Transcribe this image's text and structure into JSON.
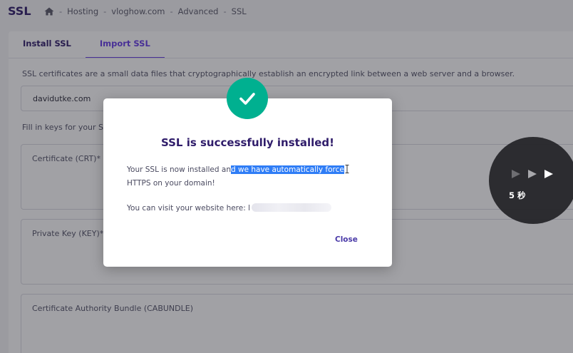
{
  "header": {
    "title": "SSL",
    "breadcrumb": [
      "Hosting",
      "vloghow.com",
      "Advanced",
      "SSL"
    ],
    "separator": "-"
  },
  "tabs": [
    {
      "label": "Install SSL",
      "active": false
    },
    {
      "label": "Import SSL",
      "active": true
    }
  ],
  "form": {
    "description": "SSL certificates are a small data files that cryptographically establish an encrypted link between a web server and a browser.",
    "domain_value": "davidutke.com",
    "fill_label": "Fill in keys for your SS",
    "certificate_label": "Certificate (CRT)*",
    "private_key_label": "Private Key (KEY)*",
    "cabundle_label": "Certificate Authority Bundle (CABUNDLE)"
  },
  "modal": {
    "title": "SSL is successfully installed!",
    "message_part1": "Your SSL is now installed an",
    "message_highlight": "d we have automatically force",
    "message_part2": "HTTPS on your domain!",
    "visit_text": "You can visit your website here: l",
    "close_label": "Close",
    "icon": "check-icon",
    "accent_color": "#00b090"
  },
  "skip_indicator": {
    "label": "5 秒",
    "icon": "fast-forward-icon"
  },
  "colors": {
    "brand": "#673de6",
    "title": "#2f1c6a",
    "success": "#00b090",
    "highlight": "#2f7df6"
  }
}
